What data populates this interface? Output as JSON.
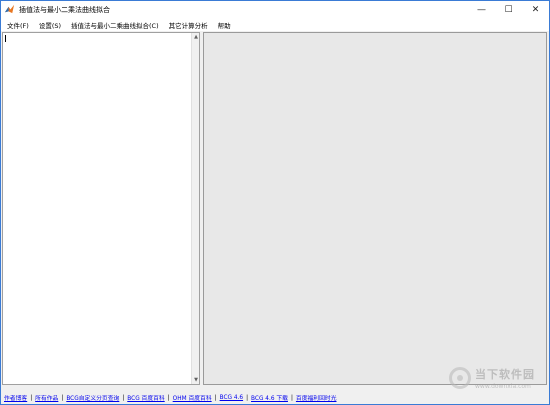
{
  "window": {
    "title": "插值法与最小二乘法曲线拟合",
    "controls": [
      "—",
      "☐",
      "✕"
    ]
  },
  "menu": [
    "文件(F)",
    "设置(S)",
    "插值法与最小二乘曲线拟合(C)",
    "其它计算分析",
    "帮助"
  ],
  "statusbar": {
    "links": [
      "作者博客",
      "所有作品",
      "BCG自定义分页查询",
      "BCG 百度百科",
      "OHM 百度百科",
      "BCG 4.6",
      "BCG 4.6 下载",
      "百度福利回时光"
    ],
    "separator": "|"
  },
  "watermark": {
    "main": "当下软件园",
    "sub": "www.downxia.com"
  },
  "scrollbar": {
    "up_arrow": "▲",
    "down_arrow": "▼"
  }
}
